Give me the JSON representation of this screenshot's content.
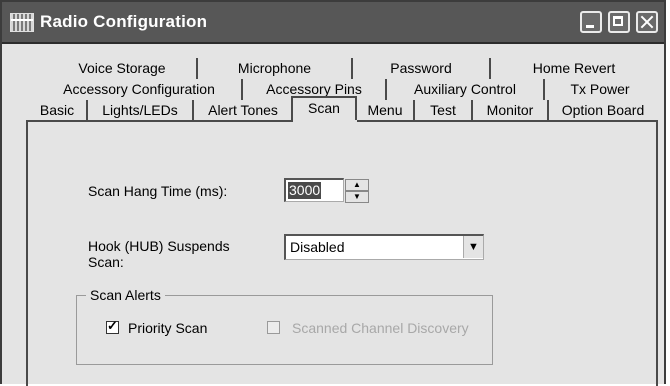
{
  "window": {
    "title": "Radio Configuration",
    "app_icon": "radio-config-icon",
    "controls": [
      "minimize-icon",
      "maximize-icon",
      "close-icon"
    ]
  },
  "tabs": {
    "row1": [
      "Voice Storage",
      "Microphone",
      "Password",
      "Home Revert"
    ],
    "row2": [
      "Accessory Configuration",
      "Accessory Pins",
      "Auxiliary Control",
      "Tx Power"
    ],
    "row3": [
      "Basic",
      "Lights/LEDs",
      "Alert Tones",
      "Scan",
      "Menu",
      "Test",
      "Monitor",
      "Option Board"
    ],
    "active": "Scan"
  },
  "scan": {
    "hang_time_label": "Scan Hang Time (ms):",
    "hang_time_value": "3000",
    "hook_label_line1": "Hook (HUB) Suspends",
    "hook_label_line2": "Scan:",
    "hook_value": "Disabled",
    "alerts_title": "Scan Alerts",
    "priority_scan_label": "Priority Scan",
    "priority_scan_checked": true,
    "channel_discovery_label": "Scanned Channel Discovery",
    "channel_discovery_checked": false,
    "channel_discovery_enabled": false
  }
}
